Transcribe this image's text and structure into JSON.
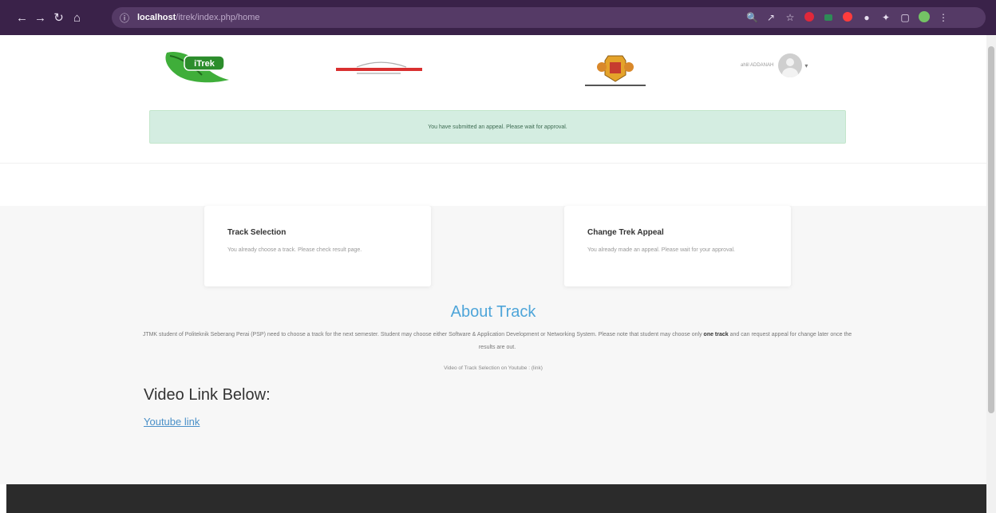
{
  "browser": {
    "url_host": "localhost",
    "url_path": "/itrek/index.php/home"
  },
  "header": {
    "user_name": "ahlil ADDANAH",
    "logo_itrek_text": "iTrek"
  },
  "alert": {
    "message": "You have submitted an appeal. Please wait for approval."
  },
  "cards": [
    {
      "title": "Track Selection",
      "text": "You already choose a track. Please check result page."
    },
    {
      "title": "Change Trek Appeal",
      "text": "You already made an appeal. Please wait for your approval."
    }
  ],
  "about": {
    "title": "About Track",
    "body_part1": "JTMK student of Politeknik Seberang Perai (PSP) need to choose a track for the next semester. Student may choose either Software & Application Development or Networking System. Please note that student may choose only ",
    "body_bold": "one track",
    "body_part2": " and can request appeal for change later once the results are out.",
    "video_note": "Video of Track Selection on Youtube : (link)"
  },
  "video": {
    "heading": "Video Link Below:",
    "link_label": "Youtube link"
  },
  "colors": {
    "chrome": "#3a2249",
    "alert_bg": "#d4ede1",
    "accent": "#4ea5d9",
    "footer": "#2b2b2b"
  }
}
